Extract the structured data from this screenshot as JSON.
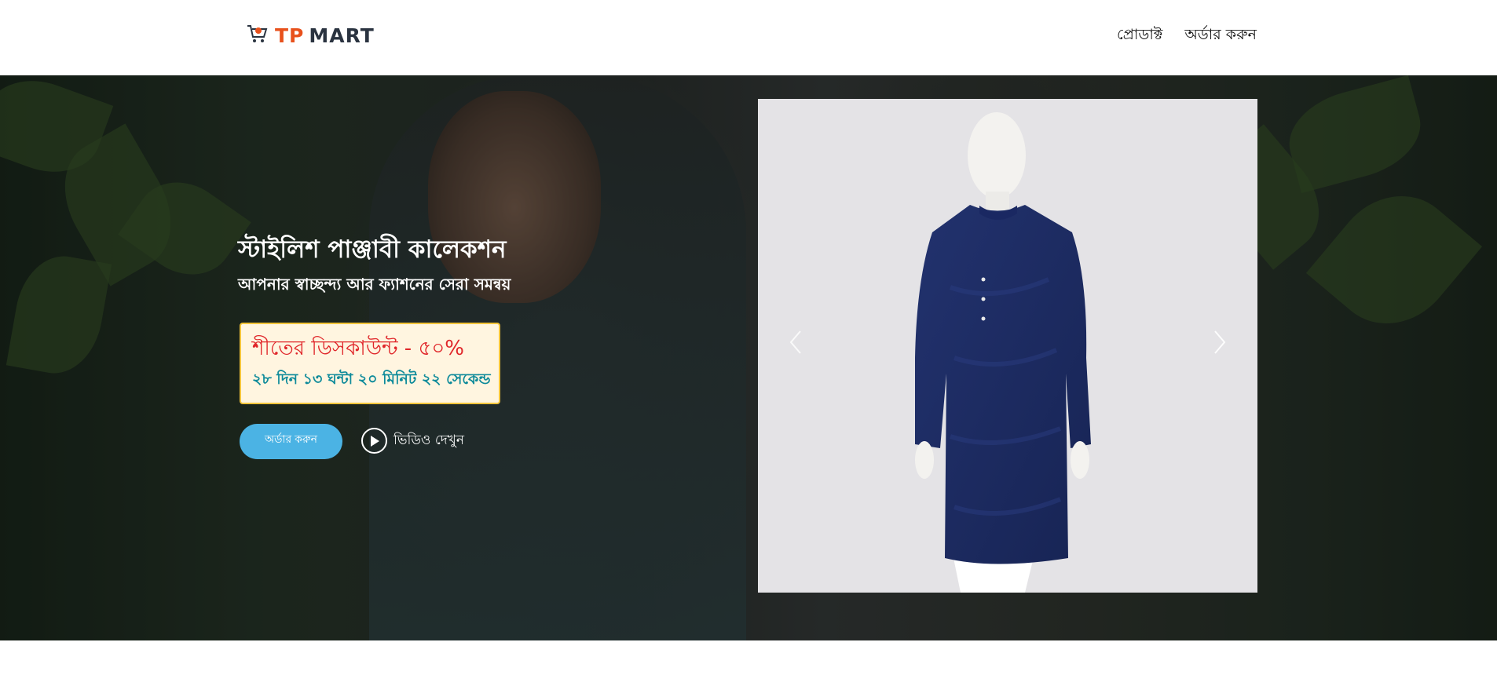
{
  "brand": {
    "tp": "TP",
    "mart": "MART",
    "accent": "#e8511c",
    "dark": "#2a3340"
  },
  "nav": {
    "products": "প্রোডাক্ট",
    "order": "অর্ডার করুন"
  },
  "hero": {
    "title": "স্টাইলিশ পাঞ্জাবী কালেকশন",
    "subtitle": "আপনার স্বাচ্ছন্দ্য আর ফ্যাশনের সেরা সমন্বয়",
    "discount_title": "শীতের ডিসকাউন্ট - ৫০%",
    "countdown": "২৮ দিন ১৩ ঘন্টা ২০ মিনিট ২২ সেকেন্ড",
    "order_button": "অর্ডার করুন",
    "video_link": "ভিডিও দেখুন"
  },
  "carousel": {
    "prev_icon": "chevron-left-icon",
    "next_icon": "chevron-right-icon",
    "product_color": "#1d2c63"
  }
}
